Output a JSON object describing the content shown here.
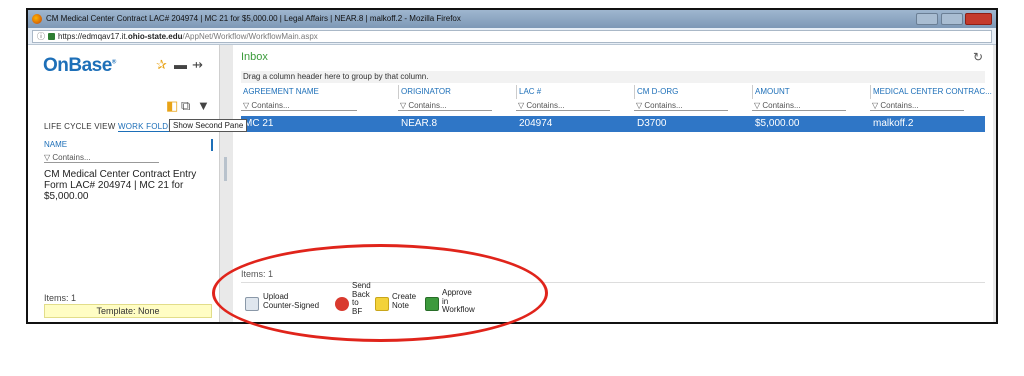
{
  "window": {
    "title": "CM Medical Center Contract LAC# 204974 | MC 21 for $5,000.00 | Legal Affairs | NEAR.8 | malkoff.2 - Mozilla Firefox",
    "url_scheme": "https://edmqav17.it.",
    "url_domain": "ohio-state.edu",
    "url_path": "/AppNet/Workflow/WorkflowMain.aspx"
  },
  "sidebar": {
    "logo": "OnBase",
    "logo_mark": "®",
    "tab_life_cycle": "LIFE CYCLE VIEW",
    "tab_work_folder": "WORK FOLDE",
    "tooltip": "Show Second Pane",
    "name_header": "NAME",
    "filter_placeholder": "▽ Contains...",
    "item": "CM Medical Center Contract Entry Form LAC# 204974 | MC 21 for $5,000.00",
    "items_count": "Items: 1",
    "template": "Template: None"
  },
  "main": {
    "title": "Inbox",
    "group_hint": "Drag a column header here to group by that column.",
    "columns": [
      "AGREEMENT NAME",
      "ORIGINATOR",
      "LAC #",
      "CM D-ORG",
      "AMOUNT",
      "MEDICAL CENTER CONTRAC..."
    ],
    "filter_placeholder": "▽ Contains...",
    "row": [
      "MC 21",
      "NEAR.8",
      "204974",
      "D3700",
      "$5,000.00",
      "malkoff.2"
    ],
    "items_count": "Items: 1"
  },
  "toolbar": {
    "upload": "Upload\nCounter-Signed",
    "send_back": "Send\nBack\nto\nBF",
    "create_note": "Create\nNote",
    "approve": "Approve\nin\nWorkflow"
  },
  "colors": {
    "accent": "#1d6fb8",
    "selected_row": "#2f76c6",
    "inbox_green": "#3a9b3a",
    "annotation": "#e0241b"
  }
}
